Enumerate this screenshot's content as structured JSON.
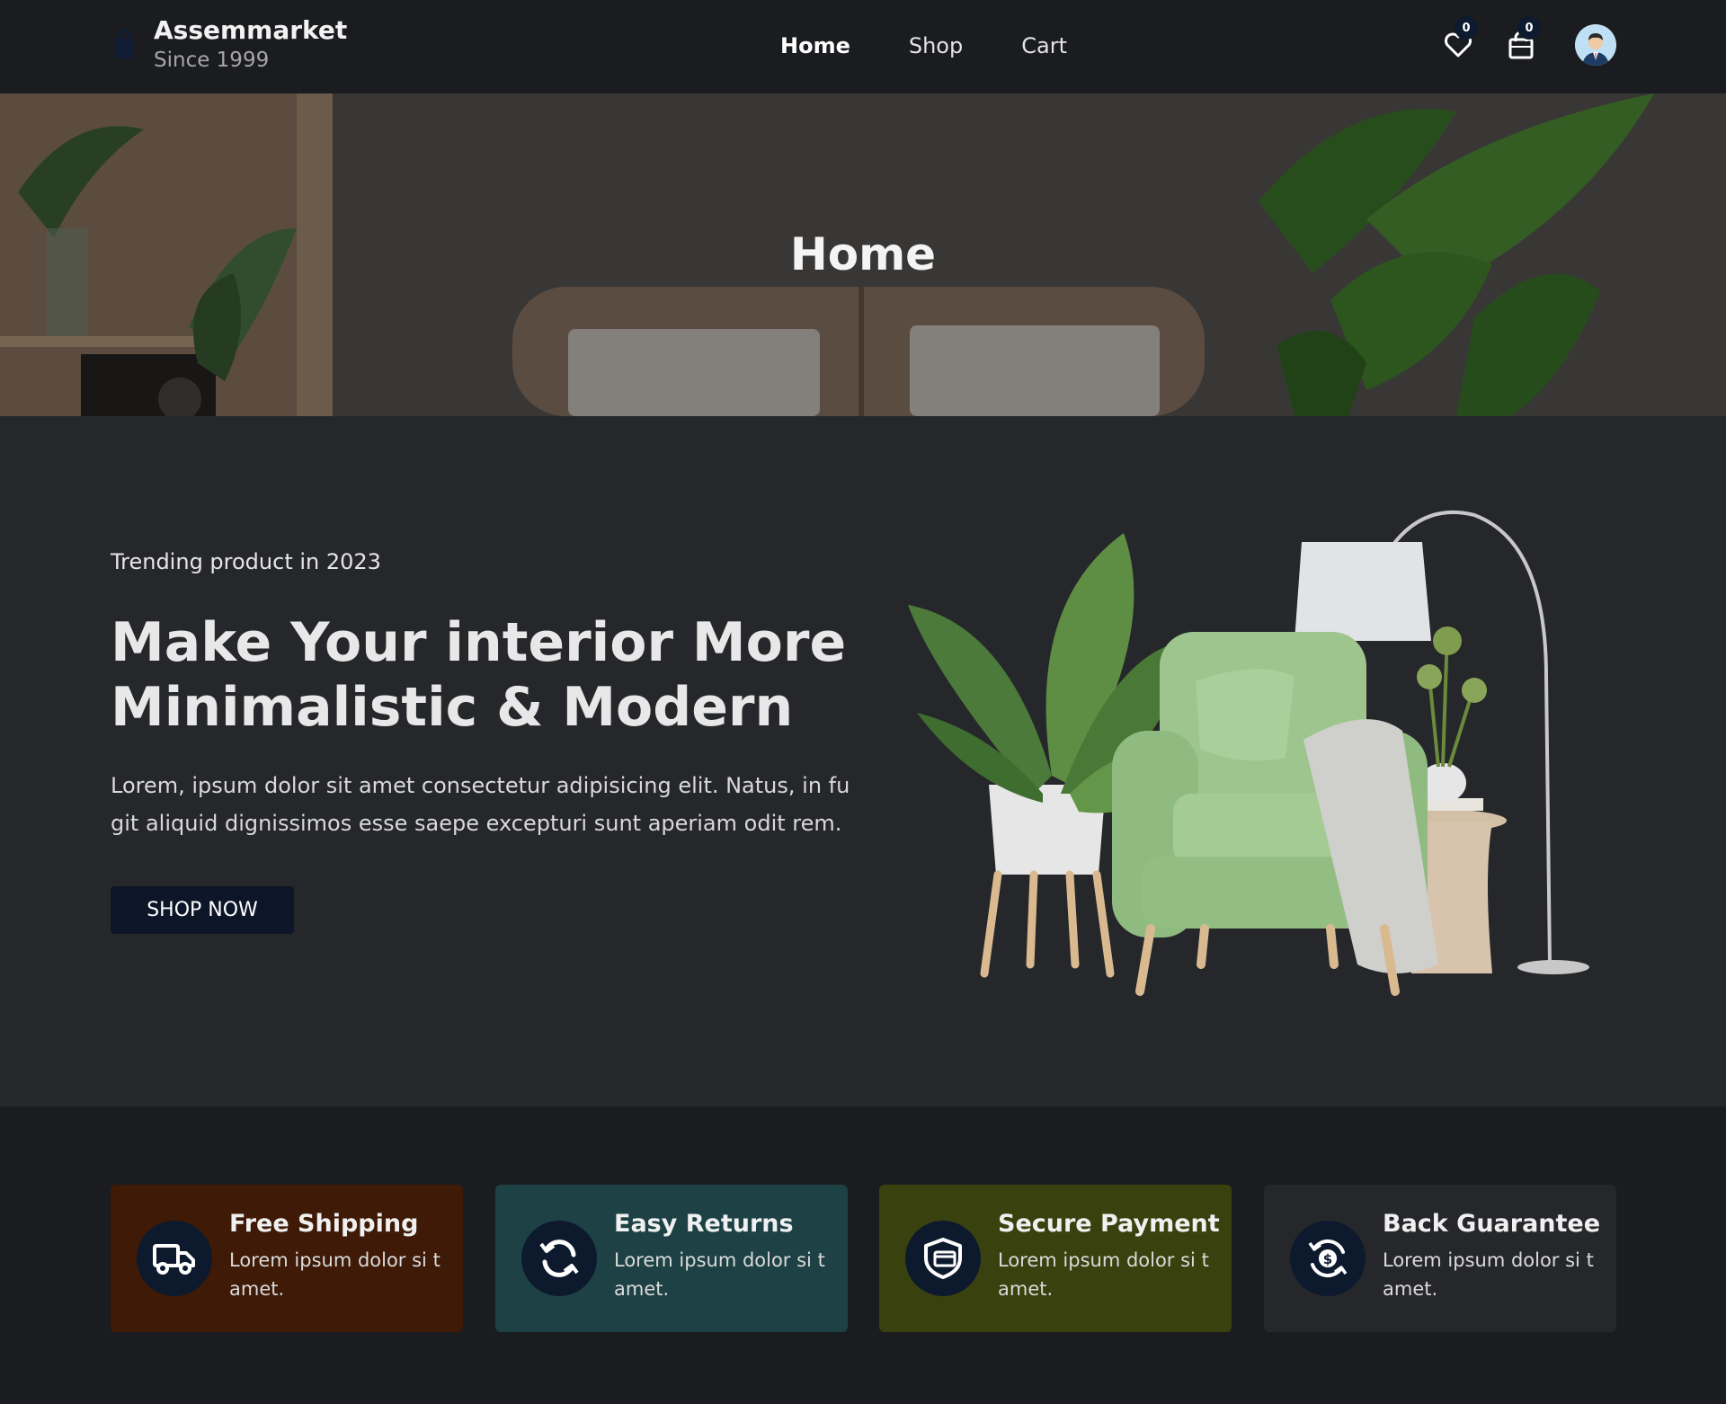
{
  "header": {
    "brand": "Assemmarket",
    "brand_sub": "Since 1999",
    "nav": [
      {
        "label": "Home",
        "active": true
      },
      {
        "label": "Shop",
        "active": false
      },
      {
        "label": "Cart",
        "active": false
      }
    ],
    "wishlist_count": "0",
    "cart_count": "0"
  },
  "banner": {
    "title": "Home"
  },
  "hero": {
    "subtitle": "Trending product in 2023",
    "title": "Make Your interior More Minimalistic & Modern",
    "text": "Lorem, ipsum dolor sit amet consectetur adipisicing elit. Natus, in fu git aliquid dignissimos esse saepe excepturi sunt aperiam odit rem.",
    "button": "SHOP NOW"
  },
  "features": [
    {
      "title": "Free Shipping",
      "text": "Lorem ipsum dolor si t amet.",
      "color": "#3e1a07",
      "icon": "truck-icon"
    },
    {
      "title": "Easy Returns",
      "text": "Lorem ipsum dolor si t amet.",
      "color": "#1d4145",
      "icon": "refresh-icon"
    },
    {
      "title": "Secure Payment",
      "text": "Lorem ipsum dolor si t amet.",
      "color": "#39410e",
      "icon": "secure-card-icon"
    },
    {
      "title": "Back Guarantee",
      "text": "Lorem ipsum dolor si t amet.",
      "color": "#26272a",
      "icon": "money-back-icon"
    }
  ]
}
